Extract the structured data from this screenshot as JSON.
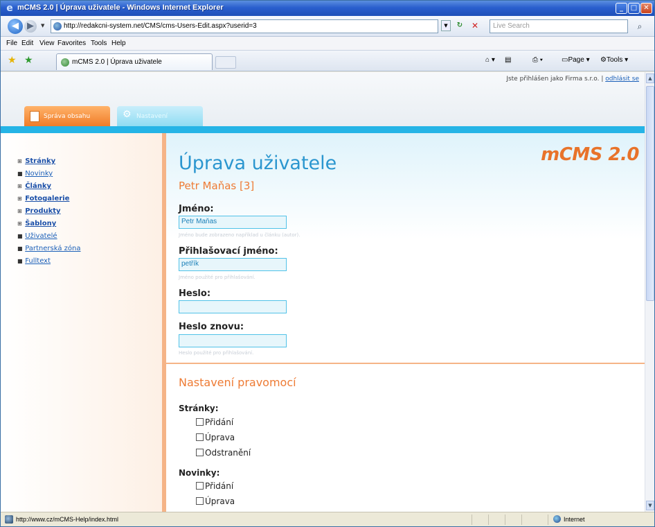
{
  "window": {
    "title": "mCMS 2.0 | Úprava uživatele - Windows Internet Explorer"
  },
  "address": {
    "url": "http://redakcni-system.net/CMS/cms-Users-Edit.aspx?userid=3",
    "search_placeholder": "Live Search"
  },
  "menu": [
    "File",
    "Edit",
    "View",
    "Favorites",
    "Tools",
    "Help"
  ],
  "tab": {
    "label": "mCMS 2.0 | Úprava uživatele"
  },
  "commands": {
    "page": "Page",
    "tools": "Tools"
  },
  "header": {
    "login_text": "Jste přihlášen jako Firma s.r.o. |",
    "logout": "odhlásit se",
    "tabs": [
      {
        "label": "Správa obsahu",
        "active": true
      },
      {
        "label": "Nastavení",
        "active": false
      }
    ],
    "logo": "mCMS 2.0"
  },
  "sidebar": {
    "items": [
      {
        "label": "Stránky",
        "bullet": "⊞"
      },
      {
        "label": "Novinky",
        "bullet": "■"
      },
      {
        "label": "Články",
        "bullet": "⊞"
      },
      {
        "label": "Fotogalerie",
        "bullet": "⊞"
      },
      {
        "label": "Produkty",
        "bullet": "⊞"
      },
      {
        "label": "Šablony",
        "bullet": "⊞"
      },
      {
        "label": "Uživatelé",
        "bullet": "■"
      },
      {
        "label": "Partnerská zóna",
        "bullet": "■"
      },
      {
        "label": "Fulltext",
        "bullet": "■"
      }
    ]
  },
  "main": {
    "title": "Úprava uživatele",
    "subtitle": "Petr Maňas [3]",
    "fields": {
      "name": {
        "label": "Jméno:",
        "value": "Petr Maňas",
        "hint": "Jméno bude zobrazeno například u článku (autor)."
      },
      "login": {
        "label": "Přihlašovací jméno:",
        "value": "petřík",
        "hint": "Jméno použité pro přihlašování."
      },
      "password": {
        "label": "Heslo:",
        "value": ""
      },
      "password_again": {
        "label": "Heslo znovu:",
        "value": "",
        "hint": "Heslo použité pro přihlašování."
      }
    },
    "permissions": {
      "title": "Nastavení pravomocí",
      "groups": [
        {
          "label": "Stránky:",
          "options": [
            "Přidání",
            "Úprava",
            "Odstranění"
          ]
        },
        {
          "label": "Novinky:",
          "options": [
            "Přidání",
            "Úprava"
          ]
        }
      ]
    }
  },
  "status": {
    "text": "http://www.cz/mCMS-Help/index.html",
    "zone": "Internet"
  }
}
